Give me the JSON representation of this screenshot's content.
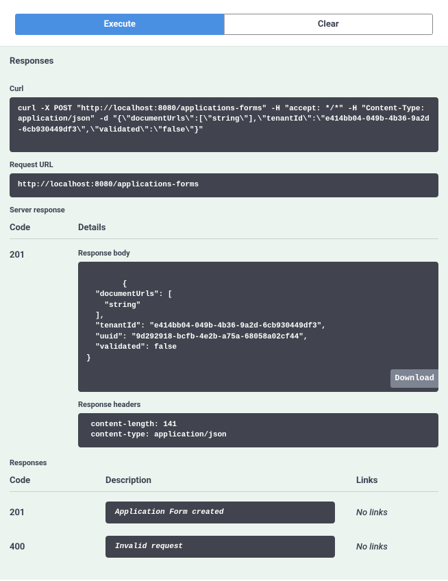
{
  "buttons": {
    "execute": "Execute",
    "clear": "Clear"
  },
  "responsesTitle": "Responses",
  "curl": {
    "label": "Curl",
    "value": "curl -X POST \"http://localhost:8080/applications-forms\" -H \"accept: */*\" -H \"Content-Type: application/json\" -d \"{\\\"documentUrls\\\":[\\\"string\\\"],\\\"tenantId\\\":\\\"e414bb04-049b-4b36-9a2d-6cb930449df3\\\",\\\"validated\\\":\\\"false\\\"}\""
  },
  "requestUrl": {
    "label": "Request URL",
    "value": "http://localhost:8080/applications-forms"
  },
  "serverResponse": {
    "label": "Server response",
    "codeHeader": "Code",
    "detailsHeader": "Details",
    "code": "201",
    "responseBodyLabel": "Response body",
    "responseBody": "{\n  \"documentUrls\": [\n    \"string\"\n  ],\n  \"tenantId\": \"e414bb04-049b-4b36-9a2d-6cb930449df3\",\n  \"uuid\": \"9d292918-bcfb-4e2b-a75a-68058a02cf44\",\n  \"validated\": false\n}",
    "downloadLabel": "Download",
    "responseHeadersLabel": "Response headers",
    "responseHeaders": " content-length: 141 \n content-type: application/json "
  },
  "responsesTable": {
    "title": "Responses",
    "codeHeader": "Code",
    "descHeader": "Description",
    "linksHeader": "Links",
    "rows": [
      {
        "code": "201",
        "desc": "Application Form created",
        "links": "No links"
      },
      {
        "code": "400",
        "desc": "Invalid request",
        "links": "No links"
      }
    ]
  }
}
